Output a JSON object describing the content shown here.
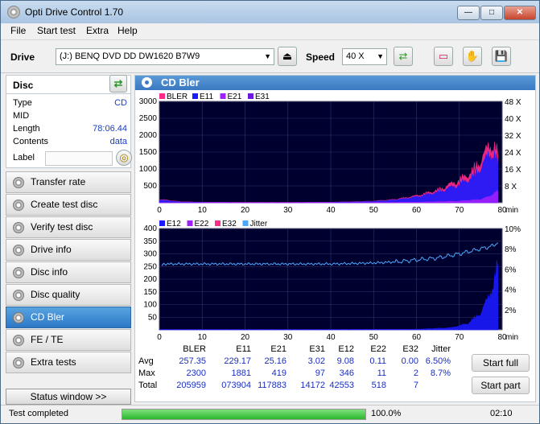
{
  "window": {
    "title": "Opti Drive Control 1.70"
  },
  "menu": [
    "File",
    "Start test",
    "Extra",
    "Help"
  ],
  "toolbar": {
    "drive_label": "Drive",
    "drive_value": "(J:)  BENQ DVD DD DW1620 B7W9",
    "speed_label": "Speed",
    "speed_value": "40 X"
  },
  "disc": {
    "title": "Disc",
    "rows": [
      {
        "label": "Type",
        "value": "CD"
      },
      {
        "label": "MID",
        "value": ""
      },
      {
        "label": "Length",
        "value": "78:06.44"
      },
      {
        "label": "Contents",
        "value": "data"
      },
      {
        "label": "Label",
        "value": ""
      }
    ]
  },
  "nav": [
    "Transfer rate",
    "Create test disc",
    "Verify test disc",
    "Drive info",
    "Disc info",
    "Disc quality",
    "CD Bler",
    "FE / TE",
    "Extra tests"
  ],
  "nav_active": "CD Bler",
  "status_window_label": "Status window >>",
  "panel": {
    "title": "CD Bler"
  },
  "stats": {
    "headers": [
      "",
      "BLER",
      "E11",
      "E21",
      "E31",
      "E12",
      "E22",
      "E32",
      "Jitter"
    ],
    "rows": [
      [
        "Avg",
        "257.35",
        "229.17",
        "25.16",
        "3.02",
        "9.08",
        "0.11",
        "0.00",
        "6.50%"
      ],
      [
        "Max",
        "2300",
        "1881",
        "419",
        "97",
        "346",
        "11",
        "2",
        "8.7%"
      ],
      [
        "Total",
        "205959",
        "073904",
        "117883",
        "14172",
        "42553",
        "518",
        "7",
        ""
      ]
    ]
  },
  "buttons": {
    "start_full": "Start full",
    "start_part": "Start part"
  },
  "status": {
    "text": "Test completed",
    "progress_text": "100.0%",
    "progress": 1.0,
    "time": "02:10"
  },
  "chart_data": [
    {
      "type": "area",
      "legend": [
        "BLER",
        "E11",
        "E21",
        "E31"
      ],
      "colors": {
        "BLER": "#ff2a8a",
        "E11": "#1a1aff",
        "E21": "#a020ff",
        "E31": "#6a1ae0"
      },
      "x_ticks": [
        "0",
        "10",
        "20",
        "30",
        "40",
        "50",
        "60",
        "70",
        "80"
      ],
      "x_unit": "min",
      "xlim": [
        0,
        80
      ],
      "y_ticks": [
        "500",
        "1000",
        "1500",
        "2000",
        "2500",
        "3000"
      ],
      "ylim": [
        0,
        3000
      ],
      "y2_ticks": [
        "8 X",
        "16 X",
        "24 X",
        "32 X",
        "40 X",
        "48 X"
      ],
      "y2lim": [
        0,
        48
      ],
      "series": [
        {
          "name": "BLER",
          "x": [
            0,
            5,
            10,
            20,
            30,
            40,
            50,
            55,
            60,
            65,
            70,
            73,
            75,
            77,
            78,
            79
          ],
          "y": [
            120,
            40,
            20,
            15,
            15,
            20,
            60,
            120,
            250,
            450,
            800,
            1100,
            1500,
            2000,
            2100,
            1700
          ]
        },
        {
          "name": "E11",
          "x": [
            0,
            5,
            10,
            20,
            30,
            40,
            50,
            55,
            60,
            65,
            70,
            73,
            75,
            77,
            78,
            79
          ],
          "y": [
            100,
            30,
            15,
            10,
            10,
            15,
            50,
            100,
            210,
            380,
            650,
            900,
            1250,
            1700,
            1800,
            1400
          ]
        },
        {
          "name": "E21",
          "x": [
            0,
            40,
            60,
            70,
            75,
            77,
            78,
            79
          ],
          "y": [
            5,
            5,
            20,
            60,
            120,
            220,
            350,
            400
          ]
        }
      ]
    },
    {
      "type": "area",
      "legend": [
        "E12",
        "E22",
        "E32",
        "Jitter"
      ],
      "colors": {
        "E12": "#1a1aff",
        "E22": "#a020ff",
        "E32": "#ff2a8a",
        "Jitter": "#4aa8ff"
      },
      "x_ticks": [
        "0",
        "10",
        "20",
        "30",
        "40",
        "50",
        "60",
        "70",
        "80"
      ],
      "x_unit": "min",
      "xlim": [
        0,
        80
      ],
      "y_ticks": [
        "50",
        "100",
        "150",
        "200",
        "250",
        "300",
        "350",
        "400"
      ],
      "ylim": [
        0,
        400
      ],
      "y2_ticks": [
        "2%",
        "4%",
        "6%",
        "8%",
        "10%"
      ],
      "y2lim": [
        0,
        10
      ],
      "series": [
        {
          "name": "E12",
          "x": [
            0,
            10,
            20,
            40,
            60,
            68,
            72,
            75,
            77,
            78,
            79
          ],
          "y": [
            2,
            2,
            2,
            2,
            3,
            10,
            30,
            80,
            160,
            230,
            300
          ]
        },
        {
          "name": "Jitter",
          "x": [
            0,
            1,
            10,
            20,
            30,
            40,
            50,
            55,
            60,
            65,
            70,
            75,
            78,
            79
          ],
          "y": [
            6.2,
            6.5,
            6.5,
            6.5,
            6.5,
            6.5,
            6.6,
            6.7,
            6.9,
            7.1,
            7.5,
            8.0,
            8.3,
            8.7
          ]
        }
      ]
    }
  ]
}
